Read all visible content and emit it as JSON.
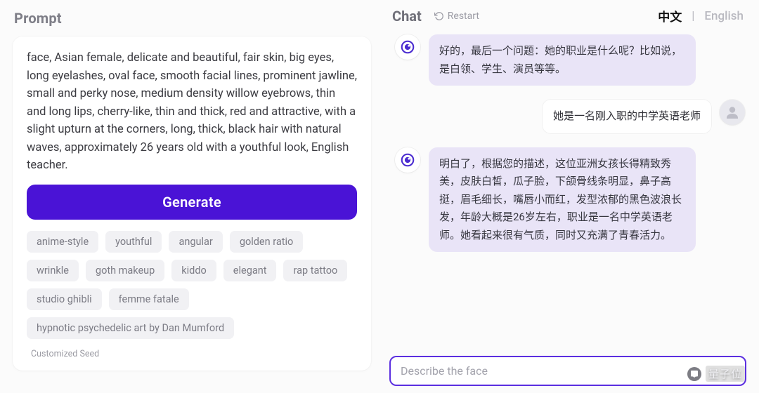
{
  "left": {
    "title": "Prompt",
    "prompt_text": "face, Asian female, delicate and beautiful, fair skin, big eyes, long eyelashes, oval face, smooth facial lines, prominent jawline, small and perky nose, medium density willow eyebrows, thin and long lips, cherry-like, thin and thick, red and attractive, with a slight upturn at the corners, long, thick, black hair with natural waves, approximately 26 years old with a youthful look, English teacher.",
    "generate_label": "Generate",
    "tags": [
      "anime-style",
      "youthful",
      "angular",
      "golden ratio",
      "wrinkle",
      "goth makeup",
      "kiddo",
      "elegant",
      "rap tattoo",
      "studio ghibli",
      "femme fatale",
      "hypnotic psychedelic art by Dan Mumford"
    ],
    "seed_label": "Customized Seed"
  },
  "right": {
    "title": "Chat",
    "restart_label": "Restart",
    "lang": {
      "active": "中文",
      "separator": "|",
      "inactive": "English"
    },
    "messages": [
      {
        "role": "bot",
        "text": "好的，最后一个问题：她的职业是什么呢？比如说，是白领、学生、演员等等。"
      },
      {
        "role": "user",
        "text": "她是一名刚入职的中学英语老师"
      },
      {
        "role": "bot",
        "text": "明白了，根据您的描述，这位亚洲女孩长得精致秀美，皮肤白皙，瓜子脸，下颌骨线条明显，鼻子高挺，眉毛细长，嘴唇小而红，发型浓郁的黑色波浪长发，年龄大概是26岁左右，职业是一名中学英语老师。她看起来很有气质，同时又充满了青春活力。"
      }
    ],
    "composer": {
      "placeholder": "Describe the face",
      "value": ""
    }
  },
  "watermark": {
    "text": "量子位"
  },
  "colors": {
    "accent": "#4a13d6",
    "input_border": "#5b2fe0",
    "bot_bubble": "#e9e4f7",
    "tag_bg": "#f1f1f4"
  }
}
